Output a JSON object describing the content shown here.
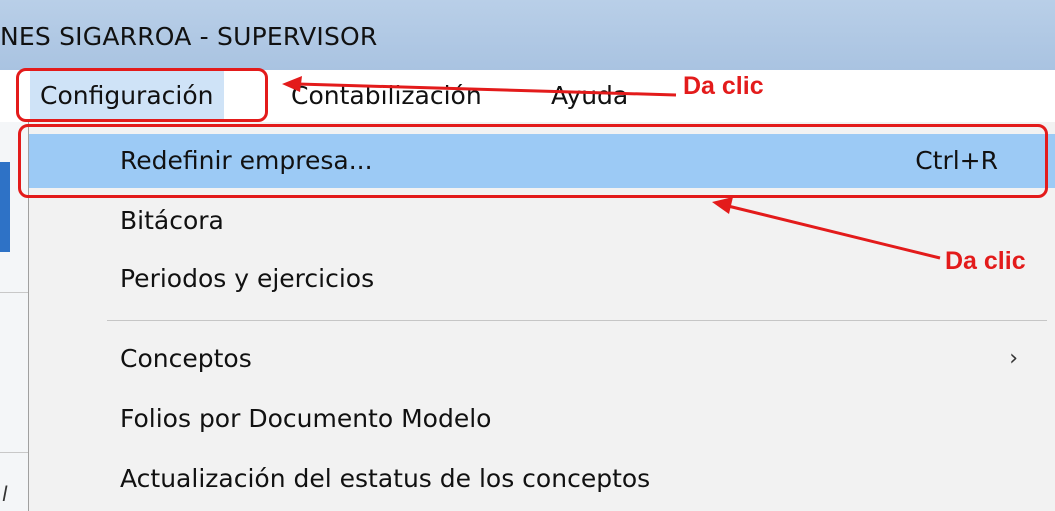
{
  "window": {
    "title": "NES SIGARROA  -  SUPERVISOR"
  },
  "menubar": {
    "items": [
      {
        "label": "Configuración"
      },
      {
        "label": "Contabilización"
      },
      {
        "label": "Ayuda"
      }
    ]
  },
  "dropdown": {
    "items": [
      {
        "label": "Redefinir empresa...",
        "shortcut": "Ctrl+R"
      },
      {
        "label": "Bitácora"
      },
      {
        "label": "Periodos y ejercicios"
      },
      {
        "label": "Conceptos",
        "submenu_icon": "chevron-right-icon",
        "submenu_glyph": "›"
      },
      {
        "label": "Folios por Documento Modelo"
      },
      {
        "label": "Actualización del estatus de los conceptos"
      }
    ]
  },
  "annotations": {
    "callout_1": "Da clic",
    "callout_2": "Da clic",
    "color": "#e31b1b"
  },
  "left_strip": {
    "glyph": "l"
  }
}
